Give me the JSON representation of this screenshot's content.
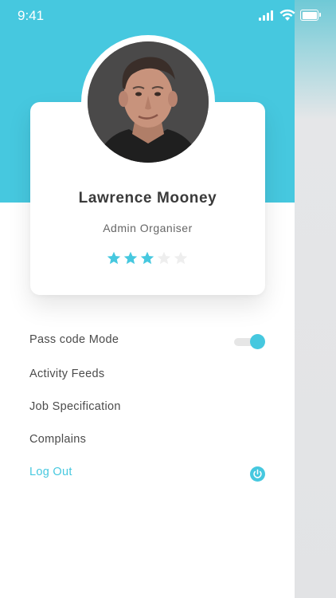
{
  "status_bar": {
    "time": "9:41"
  },
  "profile": {
    "name": "Lawrence Mooney",
    "role": "Admin Organiser",
    "rating": 3,
    "rating_max": 5
  },
  "menu": {
    "items": [
      {
        "label": "Pass code Mode"
      },
      {
        "label": "Activity Feeds"
      },
      {
        "label": "Job Specification"
      },
      {
        "label": "Complains"
      },
      {
        "label": "Log Out"
      }
    ],
    "passcode_toggle_on": true
  },
  "colors": {
    "accent": "#46c8df",
    "star_empty": "#eeeeee",
    "text": "#4b4b4b"
  },
  "icons": [
    "signal-icon",
    "wifi-icon",
    "battery-icon",
    "star-icon",
    "power-icon"
  ]
}
